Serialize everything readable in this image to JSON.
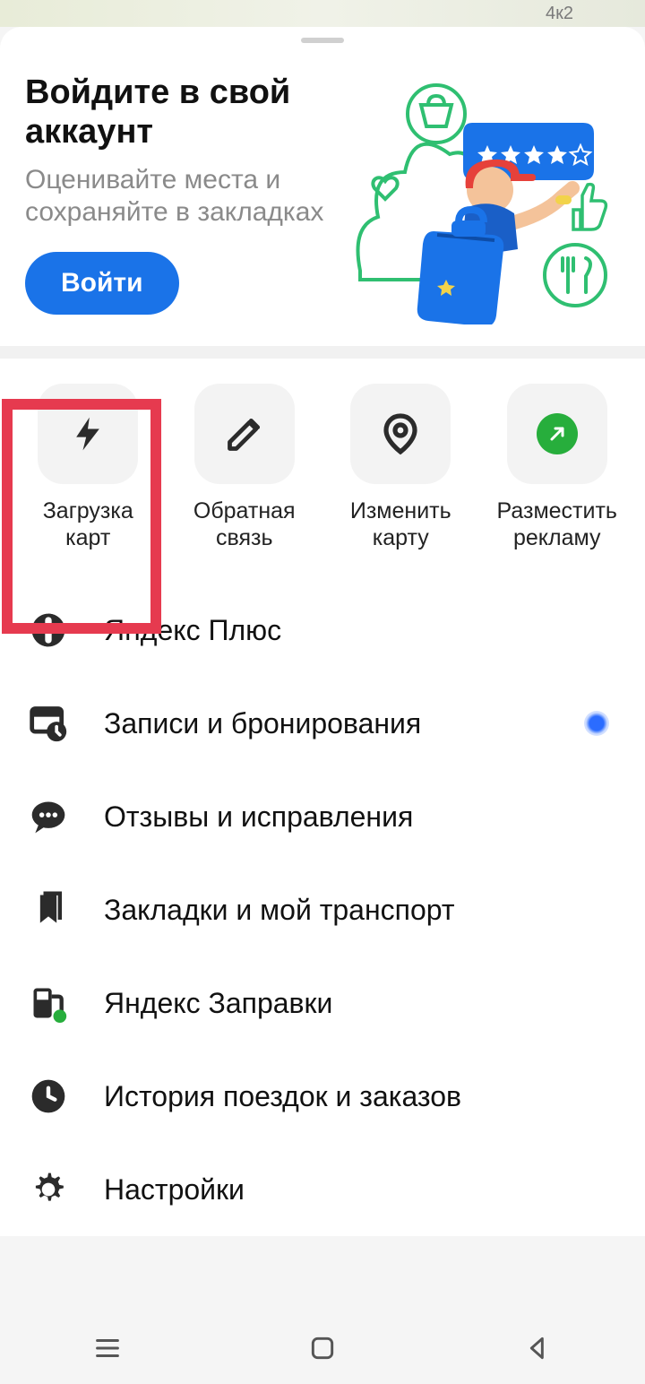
{
  "map_hint_building": "4к2",
  "login": {
    "title": "Войдите в свой аккаунт",
    "subtitle": "Оценивайте места и сохраняйте в закладках",
    "button": "Войти"
  },
  "quick_actions": [
    {
      "label": "Загрузка карт",
      "icon": "bolt"
    },
    {
      "label": "Обратная связь",
      "icon": "pencil"
    },
    {
      "label": "Изменить карту",
      "icon": "pin"
    },
    {
      "label": "Разместить рекламу",
      "icon": "arrow-up-green"
    }
  ],
  "menu": [
    {
      "label": "Яндекс Плюс",
      "icon": "plus-circle",
      "badge": null
    },
    {
      "label": "Записи и бронирования",
      "icon": "calendar-clock",
      "badge": "blue-dot"
    },
    {
      "label": "Отзывы и исправления",
      "icon": "chat",
      "badge": null
    },
    {
      "label": "Закладки и мой транспорт",
      "icon": "bookmark",
      "badge": null
    },
    {
      "label": "Яндекс Заправки",
      "icon": "fuel",
      "badge": null
    },
    {
      "label": "История поездок и заказов",
      "icon": "clock",
      "badge": null
    },
    {
      "label": "Настройки",
      "icon": "gear",
      "badge": null
    }
  ]
}
